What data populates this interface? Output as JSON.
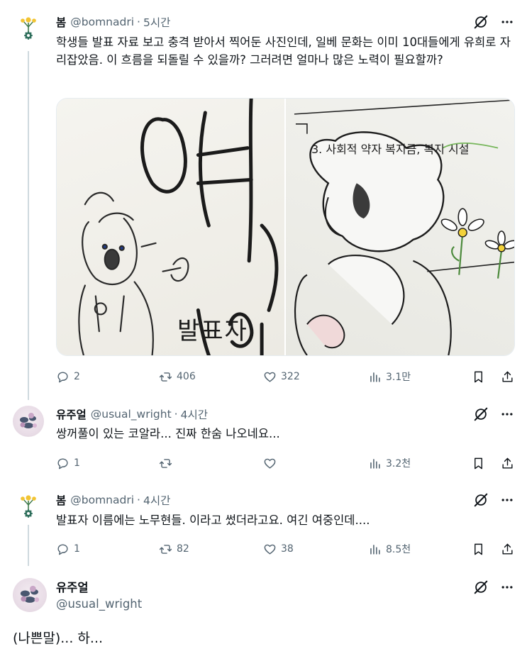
{
  "tweets": [
    {
      "name": "봄",
      "handle": "@bomnadri",
      "time": "5시간",
      "text": "학생들 발표 자료 보고 충격 받아서 찍어둔 사진인데, 일베 문화는 이미 10대들에게 유희로 자리잡았음. 이 흐름을 되돌릴 수 있을까? 그러려면 얼마나 많은 노력이 필요할까?",
      "media": {
        "left_caption": "발표자",
        "right_heading": "3. 사회적 약자 복지금, 복지 시설"
      },
      "stats": {
        "replies": "2",
        "retweets": "406",
        "likes": "322",
        "views": "3.1만"
      }
    },
    {
      "name": "유주얼",
      "handle": "@usual_wright",
      "time": "4시간",
      "text": "쌍꺼풀이 있는 코알라... 진짜 한숨 나오네요...",
      "stats": {
        "replies": "1",
        "retweets": "",
        "likes": "",
        "views": "3.2천"
      }
    },
    {
      "name": "봄",
      "handle": "@bomnadri",
      "time": "4시간",
      "text": "발표자 이름에는 노무현들. 이라고 썼더라고요. 여긴 여중인데....",
      "stats": {
        "replies": "1",
        "retweets": "82",
        "likes": "38",
        "views": "8.5천"
      }
    }
  ],
  "focused": {
    "name": "유주얼",
    "handle": "@usual_wright",
    "text": "(나쁜말)... 하..."
  },
  "separator": "·",
  "colors": {
    "text": "#0f1419",
    "muted": "#536471",
    "thread_line": "#cfd9de"
  }
}
